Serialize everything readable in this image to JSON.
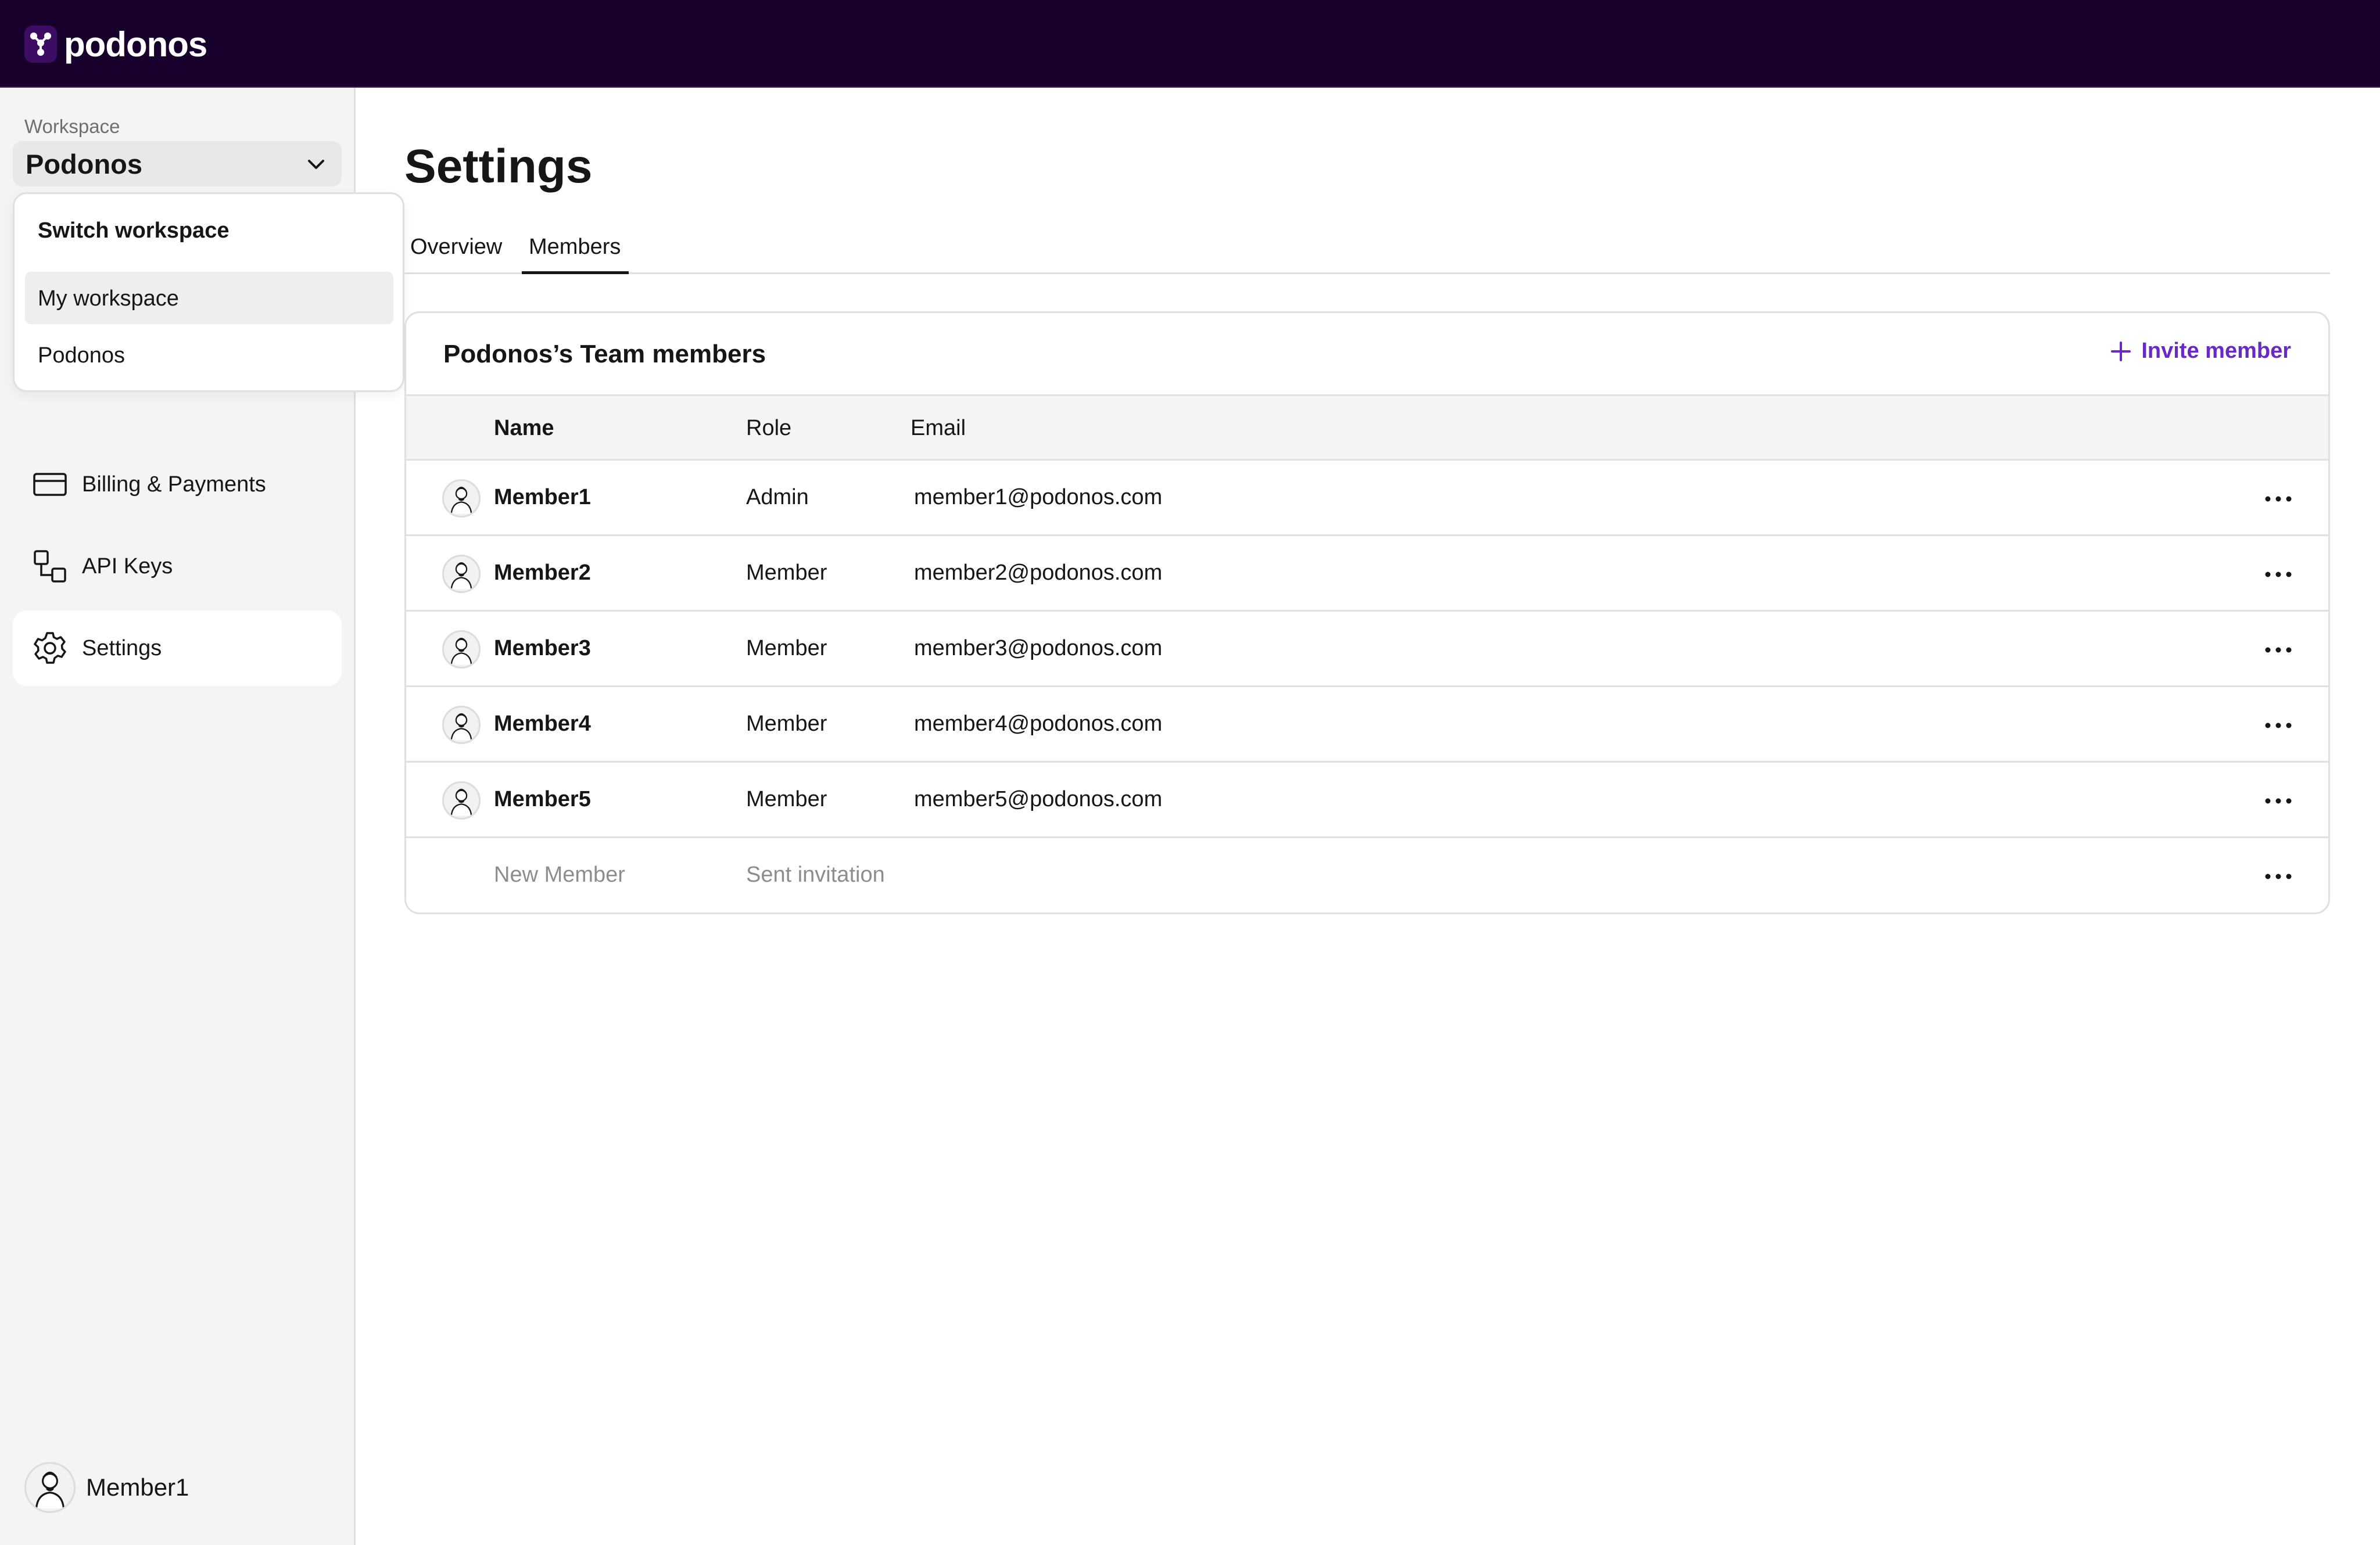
{
  "app": {
    "brand": "podonos",
    "brand_icon": "podonos-logo-icon",
    "accent_color": "#6929c4",
    "topbar_color": "#17002b"
  },
  "sidebar": {
    "workspace_label": "Workspace",
    "workspace_selected": "Podonos",
    "items": [
      {
        "label": "Billing & Payments",
        "icon": "credit-card-icon",
        "active": false
      },
      {
        "label": "API Keys",
        "icon": "api-keys-icon",
        "active": false
      },
      {
        "label": "Settings",
        "icon": "gear-icon",
        "active": true
      }
    ],
    "user": {
      "name": "Member1"
    }
  },
  "workspace_dropdown": {
    "title": "Switch workspace",
    "options": [
      {
        "label": "My workspace",
        "highlighted": true
      },
      {
        "label": "Podonos",
        "highlighted": false
      }
    ]
  },
  "main": {
    "title": "Settings",
    "tabs": [
      {
        "label": "Overview",
        "active": false
      },
      {
        "label": "Members",
        "active": true
      }
    ],
    "card": {
      "title": "Podonos’s Team members",
      "invite_label": "Invite member",
      "columns": [
        "Name",
        "Role",
        "Email"
      ],
      "rows": [
        {
          "name": "Member1",
          "role": "Admin",
          "email": "member1@podonos.com"
        },
        {
          "name": "Member2",
          "role": "Member",
          "email": "member2@podonos.com"
        },
        {
          "name": "Member3",
          "role": "Member",
          "email": "member3@podonos.com"
        },
        {
          "name": "Member4",
          "role": "Member",
          "email": "member4@podonos.com"
        },
        {
          "name": "Member5",
          "role": "Member",
          "email": "member5@podonos.com"
        },
        {
          "name": "New Member",
          "role": "Sent invitation",
          "email": ""
        }
      ]
    }
  }
}
